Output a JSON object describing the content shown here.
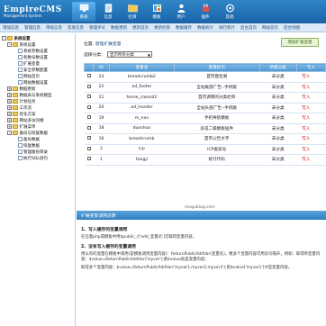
{
  "header": {
    "logo_text": "EmpireCMS",
    "logo_sub": "Management System",
    "nav": [
      {
        "label": "系统",
        "icon": "system-icon"
      },
      {
        "label": "信息",
        "icon": "info-icon"
      },
      {
        "label": "栏目",
        "icon": "column-icon"
      },
      {
        "label": "模板",
        "icon": "template-icon"
      },
      {
        "label": "用户",
        "icon": "user-icon"
      },
      {
        "label": "插件",
        "icon": "plugin-icon"
      },
      {
        "label": "其他",
        "icon": "other-icon"
      }
    ]
  },
  "subnav": [
    "增加信息",
    "管理信息",
    "审核信息",
    "签发信息",
    "管理评论",
    "数据更新",
    "更新首页",
    "更新栏目",
    "数据缓存",
    "数据统计",
    "排行统计",
    "后台首页",
    "网站首页",
    "后台地图"
  ],
  "tree": [
    {
      "label": "系统设置",
      "level": 0,
      "pm": "-",
      "kind": "folder",
      "bold": true
    },
    {
      "label": "系统设置",
      "level": 1,
      "pm": "-",
      "kind": "folder"
    },
    {
      "label": "系统参数设置",
      "level": 2,
      "pm": "",
      "kind": "doc"
    },
    {
      "label": "各数号数设置",
      "level": 2,
      "pm": "",
      "kind": "doc"
    },
    {
      "label": "扩展变量",
      "level": 2,
      "pm": "",
      "kind": "doc"
    },
    {
      "label": "安全参数配置",
      "level": 2,
      "pm": "",
      "kind": "doc"
    },
    {
      "label": "网站首页",
      "level": 2,
      "pm": "",
      "kind": "doc"
    },
    {
      "label": "网站数据设置",
      "level": 2,
      "pm": "",
      "kind": "doc"
    },
    {
      "label": "数据更新",
      "level": 1,
      "pm": "+",
      "kind": "folder"
    },
    {
      "label": "数据表与系统模型",
      "level": 1,
      "pm": "+",
      "kind": "folder"
    },
    {
      "label": "计划任务",
      "level": 1,
      "pm": "+",
      "kind": "folder"
    },
    {
      "label": "工作流",
      "level": 1,
      "pm": "+",
      "kind": "folder"
    },
    {
      "label": "优化方案",
      "level": 1,
      "pm": "+",
      "kind": "folder"
    },
    {
      "label": "网站多访问端",
      "level": 1,
      "pm": "+",
      "kind": "folder"
    },
    {
      "label": "扩展菜单",
      "level": 1,
      "pm": "+",
      "kind": "folder"
    },
    {
      "label": "备份与恢复数据",
      "level": 1,
      "pm": "-",
      "kind": "folder"
    },
    {
      "label": "备份数据",
      "level": 2,
      "pm": "",
      "kind": "doc"
    },
    {
      "label": "恢复数据",
      "level": 2,
      "pm": "",
      "kind": "doc"
    },
    {
      "label": "管理备份目录",
      "level": 2,
      "pm": "",
      "kind": "doc"
    },
    {
      "label": "执行SQL语句",
      "level": 2,
      "pm": "",
      "kind": "doc"
    }
  ],
  "main": {
    "crumb_prefix": "位置:",
    "crumb_link": "管理扩展变量",
    "add_button": "增加扩展变量",
    "category_label": "选择分类：",
    "category_value": "显示所有分类",
    "columns": [
      "ID",
      "变量名",
      "变量标识",
      "所属分类",
      "写入"
    ],
    "rows": [
      {
        "id": "23",
        "name": "breadcrumb2",
        "title": "首页面包屑",
        "cat": "未分类",
        "act": "写入"
      },
      {
        "id": "22",
        "name": "ad_footer",
        "title": "全站尾部广告--手机版",
        "cat": "未分类",
        "act": "写入"
      },
      {
        "id": "21",
        "name": "home_classid2",
        "title": "首页调用的分类栏目",
        "cat": "未分类",
        "act": "写入"
      },
      {
        "id": "20",
        "name": "ad_header",
        "title": "全站头部广告--手机版",
        "cat": "未分类",
        "act": "写入"
      },
      {
        "id": "19",
        "name": "m_nav",
        "title": "手机导航模板",
        "cat": "未分类",
        "act": "写入"
      },
      {
        "id": "18",
        "name": "duoshuo",
        "title": "多说二级模板插件",
        "cat": "未分类",
        "act": "写入"
      },
      {
        "id": "16",
        "name": "breadcrumb",
        "title": "首页公告文字",
        "cat": "未分类",
        "act": "写入"
      },
      {
        "id": "2",
        "name": "icp",
        "title": "ICP备案号",
        "cat": "未分类",
        "act": "写入"
      },
      {
        "id": "1",
        "name": "tongji",
        "title": "统计代码",
        "cat": "未分类",
        "act": "写入"
      }
    ]
  },
  "watermark": "mogubiog.com",
  "help": {
    "title": "扩展变量调用说明",
    "h1": "1、写入缓存的变量调用",
    "p1": "在任意php或模板中用$public_r['add_变量名']可取得变量内容。",
    "h2": "2、没有写入缓存的变量调用",
    "p2": "用以有的变量在模板中调用(是模板调用变量内容)：ReturnPublicAddVar(变量名)。数多个变量内容可用逗号隔开，例如：取得单变量内容：$value=ReturnPublicAddVar('myvar');则$value就是变量内容；",
    "p3": "取得多个变量内容：$value=ReturnPublicAddVar('myvar1,myvar2,myvar3');则$value['myvar1']才是变量内容。"
  }
}
